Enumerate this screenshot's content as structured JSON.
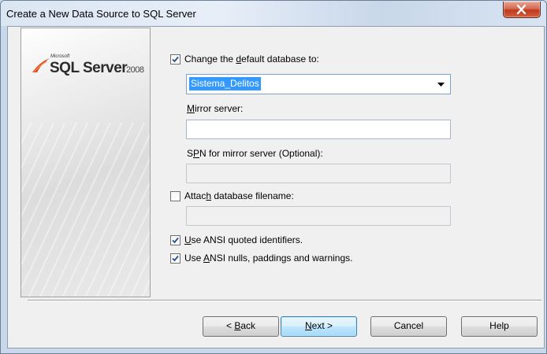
{
  "window": {
    "title": "Create a New Data Source to SQL Server"
  },
  "banner": {
    "brand_small": "Microsoft",
    "brand_main": "SQL Server",
    "brand_year": "2008"
  },
  "form": {
    "default_db": {
      "label_pre": "Change the ",
      "label_key": "d",
      "label_post": "efault database to:",
      "checked": true,
      "value": "Sistema_Delitos"
    },
    "mirror": {
      "label_key": "M",
      "label_post": "irror server:",
      "value": ""
    },
    "spn": {
      "label_pre": "S",
      "label_key": "P",
      "label_post": "N for mirror server (Optional):",
      "value": ""
    },
    "attach": {
      "label_pre": "Attac",
      "label_key": "h",
      "label_post": " database filename:",
      "checked": false,
      "value": ""
    },
    "ansi_quoted": {
      "label_key": "U",
      "label_post": "se ANSI quoted identifiers.",
      "checked": true
    },
    "ansi_nulls": {
      "label_pre": "Use ",
      "label_key": "A",
      "label_post": "NSI nulls, paddings and warnings.",
      "checked": true
    }
  },
  "buttons": {
    "back_pre": "< ",
    "back_key": "B",
    "back_post": "ack",
    "next_key": "N",
    "next_post": "ext >",
    "cancel": "Cancel",
    "help": "Help"
  },
  "colors": {
    "selection": "#3399ff",
    "close_button": "#c0391d",
    "default_button_border": "#3c7fb1"
  },
  "icons": {
    "close": "close-x-icon",
    "checkbox_check": "check-mark-icon",
    "dropdown": "chevron-down-icon",
    "logo": "sql-server-swoosh-icon"
  }
}
